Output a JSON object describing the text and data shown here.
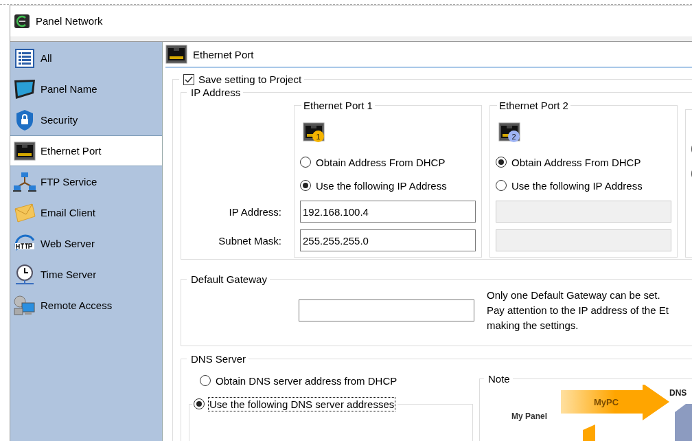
{
  "window": {
    "title": "Panel Network"
  },
  "sidebar": {
    "items": [
      {
        "label": "All",
        "kind": "list",
        "selected": false
      },
      {
        "label": "Panel Name",
        "kind": "monitor",
        "selected": false
      },
      {
        "label": "Security",
        "kind": "shield",
        "selected": false
      },
      {
        "label": "Ethernet Port",
        "kind": "ethernet",
        "selected": true
      },
      {
        "label": "FTP Service",
        "kind": "network",
        "selected": false
      },
      {
        "label": "Email Client",
        "kind": "envelope",
        "selected": false
      },
      {
        "label": "Web Server",
        "kind": "http",
        "selected": false
      },
      {
        "label": "Time Server",
        "kind": "clock",
        "selected": false
      },
      {
        "label": "Remote Access",
        "kind": "remote",
        "selected": false
      }
    ]
  },
  "header": {
    "title": "Ethernet Port"
  },
  "save_setting": {
    "label": "Save setting to Project",
    "checked": true
  },
  "ip_address": {
    "title": "IP Address",
    "labels": [
      "IP Address:",
      "Subnet Mask:"
    ],
    "ports": [
      {
        "title": "Ethernet Port 1",
        "badge": "1",
        "color": "#f5b400",
        "disabled": false,
        "options": [
          {
            "label": "Obtain Address From DHCP",
            "selected": false
          },
          {
            "label": "Use the following IP Address",
            "selected": true
          }
        ],
        "values": [
          "192.168.100.4",
          "255.255.255.0"
        ]
      },
      {
        "title": "Ethernet Port 2",
        "badge": "2",
        "color": "#9fb4f5",
        "disabled": true,
        "options": [
          {
            "label": "Obtain Address From DHCP",
            "selected": true
          },
          {
            "label": "Use the following IP Address",
            "selected": false
          }
        ]
      }
    ]
  },
  "default_gateway": {
    "title": "Default Gateway",
    "note_lines": [
      "Only one Default Gateway can be set.",
      "Pay attention to the IP address of the Et",
      "making the settings."
    ]
  },
  "dns_server": {
    "title": "DNS Server",
    "options": [
      {
        "label": "Obtain DNS server address from DHCP",
        "selected": false,
        "focused": false
      },
      {
        "label": "Use the following DNS server addresses",
        "selected": true,
        "focused": true
      }
    ]
  },
  "note": {
    "title": "Note",
    "labels": [
      "My Panel",
      "MyPC",
      "DNS"
    ]
  }
}
